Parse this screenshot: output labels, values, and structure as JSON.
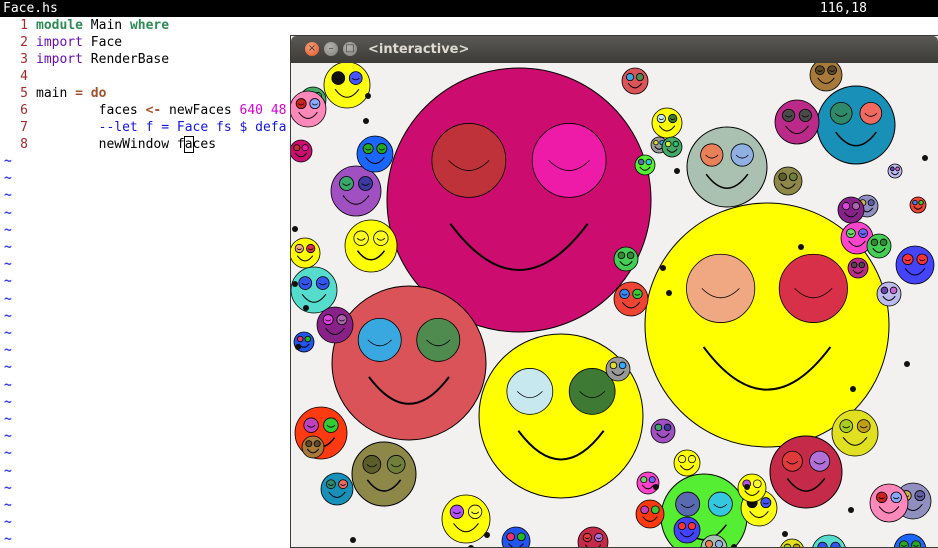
{
  "vim": {
    "filename": "Face.hs",
    "cursor_pos": "116,18",
    "lines": [
      {
        "n": "1",
        "parts": [
          {
            "t": "module",
            "c": "kw-green"
          },
          {
            "t": " Main "
          },
          {
            "t": "where",
            "c": "kw-green"
          }
        ]
      },
      {
        "n": "2",
        "parts": [
          {
            "t": "import",
            "c": "kw-purple"
          },
          {
            "t": " Face"
          }
        ]
      },
      {
        "n": "3",
        "parts": [
          {
            "t": "import",
            "c": "kw-purple"
          },
          {
            "t": " RenderBase"
          }
        ]
      },
      {
        "n": "4",
        "parts": []
      },
      {
        "n": "5",
        "parts": [
          {
            "t": "main "
          },
          {
            "t": "=",
            "c": "kw-brown"
          },
          {
            "t": " "
          },
          {
            "t": "do",
            "c": "kw-brown"
          }
        ]
      },
      {
        "n": "6",
        "parts": [
          {
            "t": "        faces "
          },
          {
            "t": "<-",
            "c": "kw-brown"
          },
          {
            "t": " newFaces "
          },
          {
            "t": "640 48",
            "c": "num-magenta"
          }
        ]
      },
      {
        "n": "7",
        "parts": [
          {
            "t": "        --let f = Face fs $ defa",
            "c": "comment"
          }
        ]
      },
      {
        "n": "8",
        "parts": [
          {
            "t": "        newWindow f"
          },
          {
            "t": "a",
            "c": "cursor"
          },
          {
            "t": "ces"
          }
        ]
      }
    ],
    "tilde": "~"
  },
  "window": {
    "title": "<interactive>",
    "close_glyph": "×",
    "min_glyph": "–",
    "max_glyph": "□",
    "background": "#f2f1f0"
  },
  "faces": [
    {
      "c": "#cc0c6e",
      "eyeL": "#c0323a",
      "eyeR": "#ee1aa8"
    },
    {
      "c": "#ffff00",
      "eyeL": "#f0a882",
      "eyeR": "#d9304a"
    },
    {
      "c": "#d95358",
      "eyeL": "#3aa8e0",
      "eyeR": "#4f8a4f"
    },
    {
      "c": "#ffff00",
      "eyeL": "#c8e8f0",
      "eyeR": "#3f7a35"
    },
    {
      "c": "#55ee33",
      "eyeL": "#5a6ab0",
      "eyeR": "#33c8e0"
    },
    {
      "c": "#aac0b0",
      "eyeL": "#e8805a",
      "eyeR": "#8fb0e0"
    },
    {
      "c": "#1890b8",
      "eyeL": "#2f8a6a",
      "eyeR": "#f06a60"
    },
    {
      "c": "#c52a48",
      "eyeL": "#e03a3a",
      "eyeR": "#b070d8"
    },
    {
      "c": "#8e8848",
      "eyeL": "#5d5d2a",
      "eyeR": "#6f7f3a"
    },
    {
      "c": "#ffff11",
      "eyeL": "#111111",
      "eyeR": "#4455ff"
    },
    {
      "c": "#ffff00",
      "eyeL": "#ffff22",
      "eyeR": "#ffff22"
    },
    {
      "c": "#a050c0",
      "eyeL": "#3aa86a",
      "eyeR": "#3a3aa0"
    },
    {
      "c": "#ff3a10",
      "eyeL": "#c040c0",
      "eyeR": "#33cc33"
    },
    {
      "c": "#ffff00",
      "eyeL": "#b050ff",
      "eyeR": "#ffff33"
    },
    {
      "c": "#bb2a88",
      "eyeL": "#4a4a4a",
      "eyeR": "#4a4a4a"
    },
    {
      "c": "#1a66ff",
      "eyeL": "#22aa22",
      "eyeR": "#22aa22"
    },
    {
      "c": "#55dccc",
      "eyeL": "#3355ee",
      "eyeR": "#3355ee"
    },
    {
      "c": "#e0e020",
      "eyeL": "#aacc22",
      "eyeR": "#c0a010"
    },
    {
      "c": "#9090c0",
      "eyeL": "#d0b050",
      "eyeR": "#6060a0"
    },
    {
      "c": "#ff88bb",
      "eyeL": "#cc2222",
      "eyeR": "#88aaff"
    },
    {
      "c": "#a87a3a",
      "eyeL": "#5f4a2a",
      "eyeR": "#5f4a2a"
    },
    {
      "c": "#2255ee",
      "eyeL": "#ee3366",
      "eyeR": "#22bb22"
    },
    {
      "c": "#ff44cc",
      "eyeL": "#66dd66",
      "eyeR": "#6666ff"
    },
    {
      "c": "#4444ff",
      "eyeL": "#ff3333",
      "eyeR": "#ff3333"
    },
    {
      "c": "#44cc55",
      "eyeL": "#338833",
      "eyeR": "#338833"
    },
    {
      "c": "#882288",
      "eyeL": "#dd44dd",
      "eyeR": "#aa66aa"
    },
    {
      "c": "#ee4433",
      "eyeL": "#3388ff",
      "eyeR": "#33cc33"
    },
    {
      "c": "#999999",
      "eyeL": "#dddd33",
      "eyeR": "#33aaff"
    },
    {
      "c": "#44aa66",
      "eyeL": "#ccee44",
      "eyeR": "#22bb77"
    },
    {
      "c": "#bbbbee",
      "eyeL": "#6644aa",
      "eyeR": "#cc66cc"
    }
  ]
}
